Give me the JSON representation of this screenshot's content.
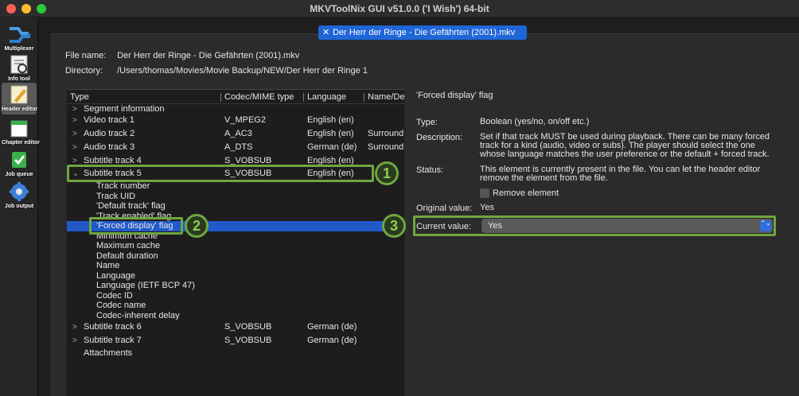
{
  "window": {
    "title": "MKVToolNix GUI v51.0.0 ('I Wish') 64-bit"
  },
  "toolbar": [
    {
      "label": "Multiplexer",
      "icon": "multiplexer-icon"
    },
    {
      "label": "Info tool",
      "icon": "info-tool-icon"
    },
    {
      "label": "Header editor",
      "icon": "header-editor-icon"
    },
    {
      "label": "Chapter editor",
      "icon": "chapter-editor-icon"
    },
    {
      "label": "Job queue",
      "icon": "job-queue-icon"
    },
    {
      "label": "Job output",
      "icon": "job-output-icon"
    }
  ],
  "document_tab": {
    "close": "✕",
    "label": "Der Herr der Ringe - Die Gefährten (2001).mkv"
  },
  "file": {
    "name_label": "File name:",
    "name": "Der Herr der Ringe - Die Gefährten (2001).mkv",
    "dir_label": "Directory:",
    "dir": "/Users/thomas/Movies/Movie Backup/NEW/Der Herr der Ringe 1"
  },
  "tree": {
    "columns": [
      "Type",
      "Codec/MIME type",
      "Language",
      "Name/De"
    ],
    "rows": [
      {
        "name": "Segment information",
        "codec": "",
        "lang": "",
        "extra": "",
        "chev": ">"
      },
      {
        "name": "Video track 1",
        "codec": "V_MPEG2",
        "lang": "English (en)",
        "extra": "",
        "chev": ">"
      },
      {
        "name": "Audio track 2",
        "codec": "A_AC3",
        "lang": "English (en)",
        "extra": "Surround",
        "chev": ">"
      },
      {
        "name": "Audio track 3",
        "codec": "A_DTS",
        "lang": "German (de)",
        "extra": "Surround",
        "chev": ">"
      },
      {
        "name": "Subtitle track 4",
        "codec": "S_VOBSUB",
        "lang": "English (en)",
        "extra": "",
        "chev": ">"
      },
      {
        "name": "Subtitle track 5",
        "codec": "S_VOBSUB",
        "lang": "English (en)",
        "extra": "",
        "chev": "⌄"
      },
      {
        "name": "Track number",
        "codec": "",
        "lang": "",
        "extra": "",
        "chev": ""
      },
      {
        "name": "Track UID",
        "codec": "",
        "lang": "",
        "extra": "",
        "chev": ""
      },
      {
        "name": "'Default track' flag",
        "codec": "",
        "lang": "",
        "extra": "",
        "chev": ""
      },
      {
        "name": "'Track enabled' flag",
        "codec": "",
        "lang": "",
        "extra": "",
        "chev": ""
      },
      {
        "name": "'Forced display' flag",
        "codec": "",
        "lang": "",
        "extra": "",
        "chev": ""
      },
      {
        "name": "Minimum cache",
        "codec": "",
        "lang": "",
        "extra": "",
        "chev": ""
      },
      {
        "name": "Maximum cache",
        "codec": "",
        "lang": "",
        "extra": "",
        "chev": ""
      },
      {
        "name": "Default duration",
        "codec": "",
        "lang": "",
        "extra": "",
        "chev": ""
      },
      {
        "name": "Name",
        "codec": "",
        "lang": "",
        "extra": "",
        "chev": ""
      },
      {
        "name": "Language",
        "codec": "",
        "lang": "",
        "extra": "",
        "chev": ""
      },
      {
        "name": "Language (IETF BCP 47)",
        "codec": "",
        "lang": "",
        "extra": "",
        "chev": ""
      },
      {
        "name": "Codec ID",
        "codec": "",
        "lang": "",
        "extra": "",
        "chev": ""
      },
      {
        "name": "Codec name",
        "codec": "",
        "lang": "",
        "extra": "",
        "chev": ""
      },
      {
        "name": "Codec-inherent delay",
        "codec": "",
        "lang": "",
        "extra": "",
        "chev": ""
      },
      {
        "name": "Subtitle track 6",
        "codec": "S_VOBSUB",
        "lang": "German (de)",
        "extra": "",
        "chev": ">"
      },
      {
        "name": "Subtitle track 7",
        "codec": "S_VOBSUB",
        "lang": "German (de)",
        "extra": "",
        "chev": ">"
      },
      {
        "name": "Attachments",
        "codec": "",
        "lang": "",
        "extra": "",
        "chev": ""
      }
    ]
  },
  "detail": {
    "heading": "'Forced display' flag",
    "type_label": "Type:",
    "type_value": "Boolean (yes/no, on/off etc.)",
    "desc_label": "Description:",
    "desc_value": "Set if that track MUST be used during playback. There can be many forced track for a kind (audio, video or subs). The player should select the one whose language matches the user preference or the default + forced track.",
    "status_label": "Status:",
    "status_value": "This element is currently present in the file. You can let the header editor remove the element from the file.",
    "remove_label": "Remove element",
    "orig_label": "Original value:",
    "orig_value": "Yes",
    "current_label": "Current value:",
    "current_value": "Yes",
    "select_arrows": "⌃⌄"
  },
  "badges": [
    "1",
    "2",
    "3"
  ],
  "colors": {
    "accent": "#2159c9",
    "highlight": "#6ea640"
  }
}
